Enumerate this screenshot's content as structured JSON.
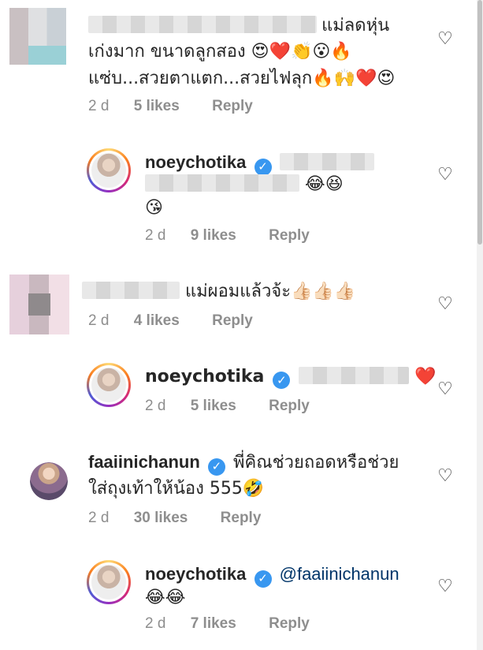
{
  "comments": [
    {
      "lines": [
        "แม่ลดหุ่น",
        "เก่งมาก ขนาดลูกสอง 😍❤️👏😮🔥",
        "แซ่บ...สวยตาแตก...สวยไฟลุก🔥🙌❤️😍"
      ],
      "time": "2 d",
      "likes": "5 likes",
      "reply": "Reply"
    },
    {
      "user": "noeychotika",
      "lines": [
        "😂😆",
        "😘"
      ],
      "time": "2 d",
      "likes": "9 likes",
      "reply": "Reply"
    },
    {
      "lines": [
        "แม่ผอมแล้วจ้ะ👍🏻👍🏻👍🏻"
      ],
      "time": "2 d",
      "likes": "4 likes",
      "reply": "Reply"
    },
    {
      "user": "noeychotika",
      "lines": [
        "❤️"
      ],
      "time": "2 d",
      "likes": "5 likes",
      "reply": "Reply"
    },
    {
      "user": "faaiinichanun",
      "lines": [
        "พี่คิณช่วยถอดหรือช่วย",
        "ใส่ถุงเท้าให้น้อง 555🤣"
      ],
      "time": "2 d",
      "likes": "30 likes",
      "reply": "Reply"
    },
    {
      "user": "noeychotika",
      "mention": "@faaiinichanun",
      "lines": [
        "😂😂"
      ],
      "time": "2 d",
      "likes": "7 likes",
      "reply": "Reply"
    }
  ],
  "icons": {
    "like": "heart-outline-icon",
    "verified": "verified-badge-icon"
  },
  "colors": {
    "verified": "#3897f0",
    "meta": "#8e8e8e",
    "mention": "#003569"
  }
}
